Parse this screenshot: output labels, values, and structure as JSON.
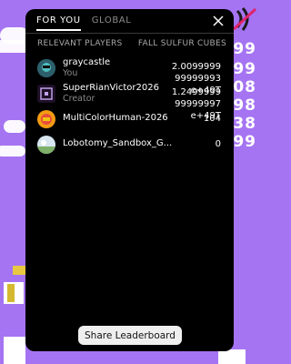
{
  "background": {
    "numbers": [
      "999",
      "999",
      "408",
      "698",
      "038",
      "199"
    ]
  },
  "tabs": [
    {
      "label": "FOR YOU",
      "active": true
    },
    {
      "label": "GLOBAL",
      "active": false
    }
  ],
  "columns": {
    "left": "RELEVANT PLAYERS",
    "right": "FALL SULFUR CUBES"
  },
  "players": [
    {
      "name": "graycastle",
      "role": "You",
      "score": "2.0099999 99999993 e+49T",
      "avatar": "avatar-graycastle"
    },
    {
      "name": "SuperRianVictor2026",
      "role": "Creator",
      "score": "1.2499999 99999997 e+49T",
      "avatar": "avatar-superrian"
    },
    {
      "name": "MultiColorHuman-2026",
      "role": "",
      "score": "104",
      "avatar": "avatar-multicolor"
    },
    {
      "name": "Lobotomy_Sandbox_G...",
      "role": "",
      "score": "0",
      "avatar": "avatar-lobotomy"
    }
  ],
  "share_button": "Share Leaderboard",
  "colors": {
    "background": "#a574f2",
    "panel": "#000000",
    "button": "#efefef"
  }
}
